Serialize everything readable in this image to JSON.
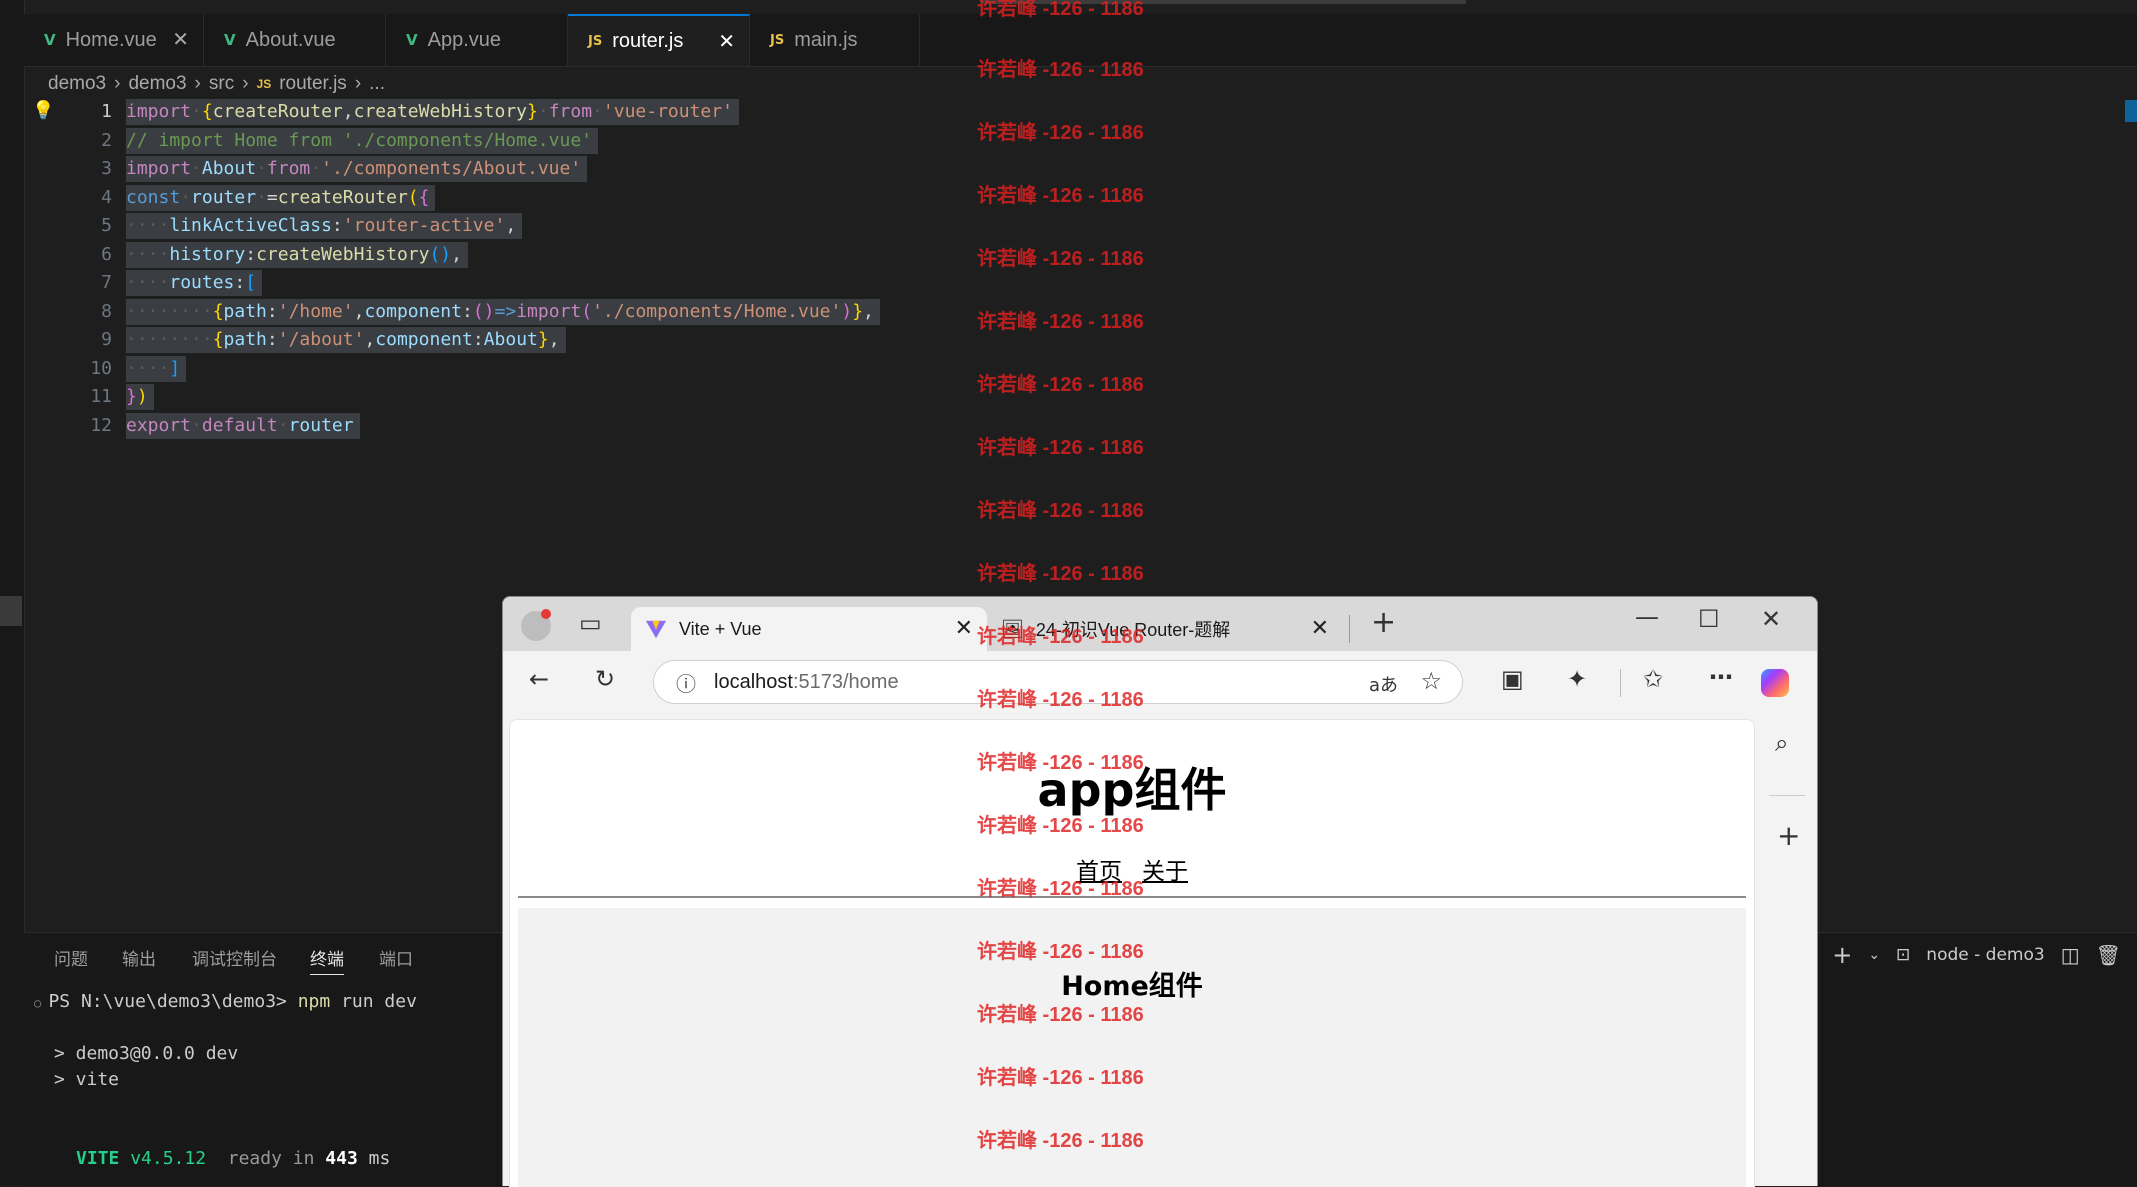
{
  "tabs": [
    {
      "label": "Home.vue",
      "icon": "vue-icon"
    },
    {
      "label": "About.vue",
      "icon": "vue-icon"
    },
    {
      "label": "App.vue",
      "icon": "vue-icon"
    },
    {
      "label": "router.js",
      "icon": "js-icon",
      "active": true
    },
    {
      "label": "main.js",
      "icon": "js-icon"
    }
  ],
  "breadcrumb": [
    "demo3",
    "demo3",
    "src",
    "router.js",
    "..."
  ],
  "js_badge": "JS",
  "vue_badge": "V",
  "line_numbers": [
    "1",
    "2",
    "3",
    "4",
    "5",
    "6",
    "7",
    "8",
    "9",
    "10",
    "11",
    "12"
  ],
  "code_tokens": {
    "import": "import",
    "from": "from",
    "const": "const",
    "export": "export",
    "default": "default",
    "createRouter": "createRouter",
    "createWebHistory": "createWebHistory",
    "vue_router": "'vue-router'",
    "comment": "// import Home from './components/Home.vue'",
    "About": "About",
    "about_path": "'./components/About.vue'",
    "router": "router",
    "linkActiveClass": "linkActiveClass",
    "router_active": "'router-active'",
    "history": "history",
    "routes": "routes",
    "path": "path",
    "component": "component",
    "home_path": "'/home'",
    "home_comp_path": "'./components/Home.vue'",
    "about_route": "'/about'"
  },
  "panel": {
    "tabs": [
      "问题",
      "输出",
      "调试控制台",
      "终端",
      "端口"
    ],
    "active_tab": "终端",
    "terminal_name": "node - demo3",
    "lines": {
      "prompt": "PS N:\\vue\\demo3\\demo3>",
      "cmd1": "npm",
      "cmd2": " run dev",
      "l2": "> demo3@0.0.0 dev",
      "l3": "> vite",
      "vite": "VITE",
      "version": " v4.5.12",
      "ready": "  ready in ",
      "ms_value": "443",
      "ms": " ms"
    }
  },
  "browser": {
    "tabs": [
      {
        "label": "Vite + Vue",
        "active": true
      },
      {
        "label": "24-初识Vue Router-题解",
        "active": false
      }
    ],
    "url_host": "localhost",
    "url_path": ":5173/home",
    "read_aloud": "aあ",
    "app_title": "app组件",
    "nav_links": [
      "首页",
      "关于"
    ],
    "home_title": "Home组件"
  },
  "watermark": "许若峰 -126 - 1186",
  "colors": {
    "accent": "#0078d4",
    "vue_green": "#41b883",
    "js_yellow": "#e8c14a",
    "watermark_red": "#e02020"
  }
}
